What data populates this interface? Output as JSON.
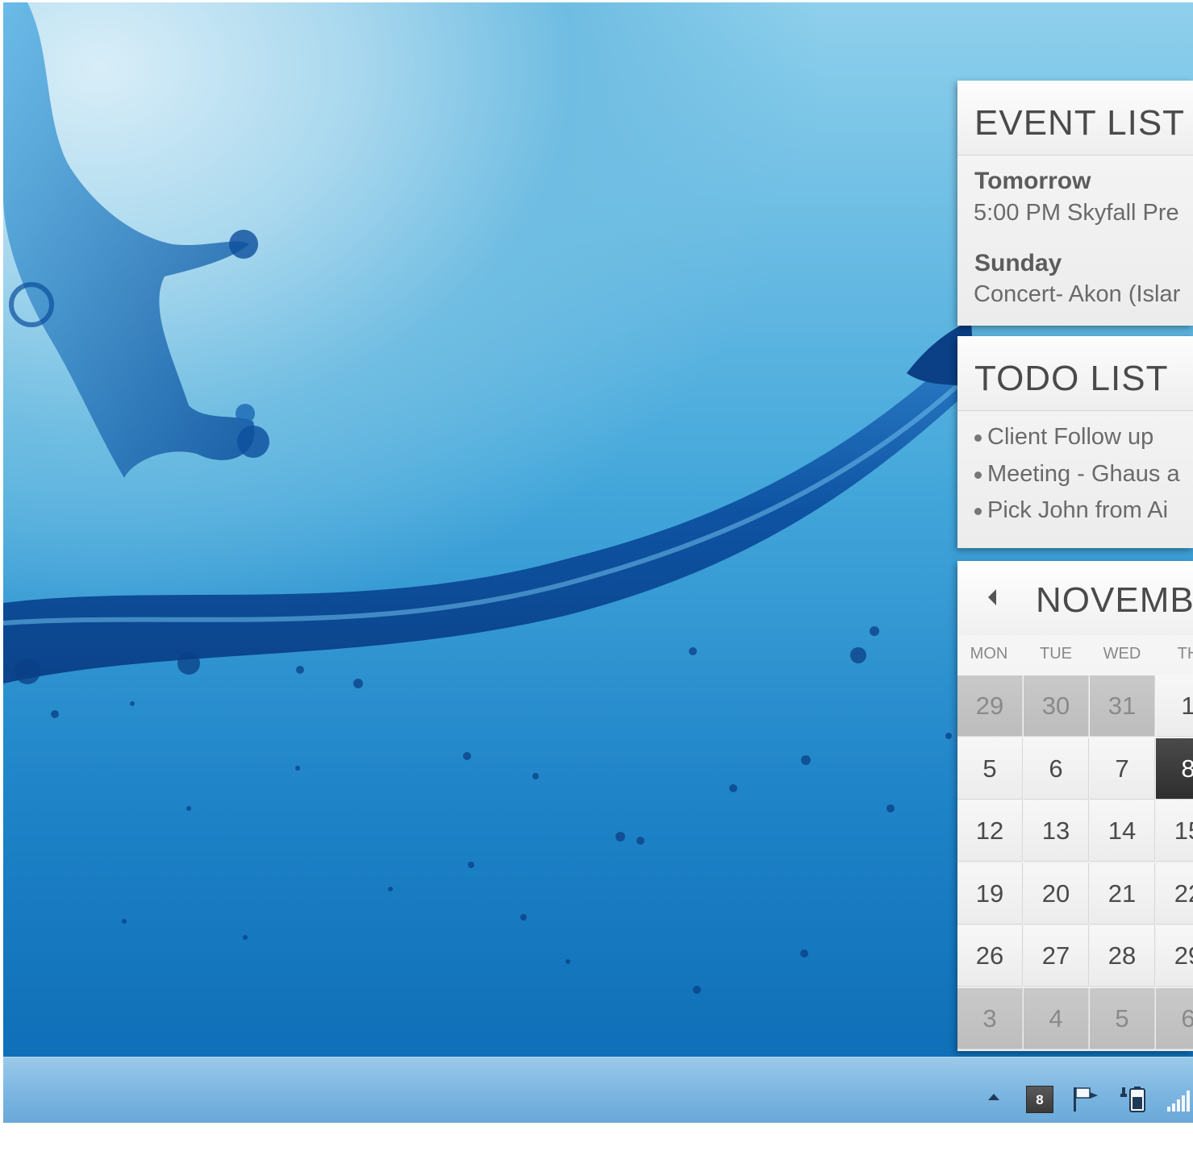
{
  "event_list": {
    "title": "EVENT LIST",
    "events": [
      {
        "day": "Tomorrow",
        "text": "5:00 PM Skyfall Pre"
      },
      {
        "day": "Sunday",
        "text": "Concert- Akon (Islar"
      }
    ]
  },
  "todo_list": {
    "title": "TODO LIST",
    "items": [
      "Client Follow up",
      "Meeting - Ghaus a",
      "Pick John from Ai"
    ]
  },
  "calendar": {
    "month_label": "NOVEMB",
    "weekdays": [
      "MON",
      "TUE",
      "WED",
      "TH"
    ],
    "weeks": [
      [
        {
          "d": "29",
          "other": true
        },
        {
          "d": "30",
          "other": true
        },
        {
          "d": "31",
          "other": true
        },
        {
          "d": "1"
        }
      ],
      [
        {
          "d": "5"
        },
        {
          "d": "6"
        },
        {
          "d": "7"
        },
        {
          "d": "8",
          "today": true
        }
      ],
      [
        {
          "d": "12"
        },
        {
          "d": "13"
        },
        {
          "d": "14"
        },
        {
          "d": "15"
        }
      ],
      [
        {
          "d": "19"
        },
        {
          "d": "20"
        },
        {
          "d": "21"
        },
        {
          "d": "22"
        }
      ],
      [
        {
          "d": "26"
        },
        {
          "d": "27"
        },
        {
          "d": "28"
        },
        {
          "d": "29"
        }
      ],
      [
        {
          "d": "3",
          "other": true
        },
        {
          "d": "4",
          "other": true
        },
        {
          "d": "5",
          "other": true
        },
        {
          "d": "6",
          "other": true
        }
      ]
    ]
  },
  "taskbar": {
    "date_badge": "8",
    "icons": [
      "show-hidden-icons-icon",
      "action-center-flag-icon",
      "power-icon",
      "network-signal-icon"
    ]
  },
  "colors": {
    "widget_bg": "#ececec",
    "today_bg": "#2e2e2e",
    "taskbar": "#7eb7e2",
    "water": "#0f6fb8"
  }
}
